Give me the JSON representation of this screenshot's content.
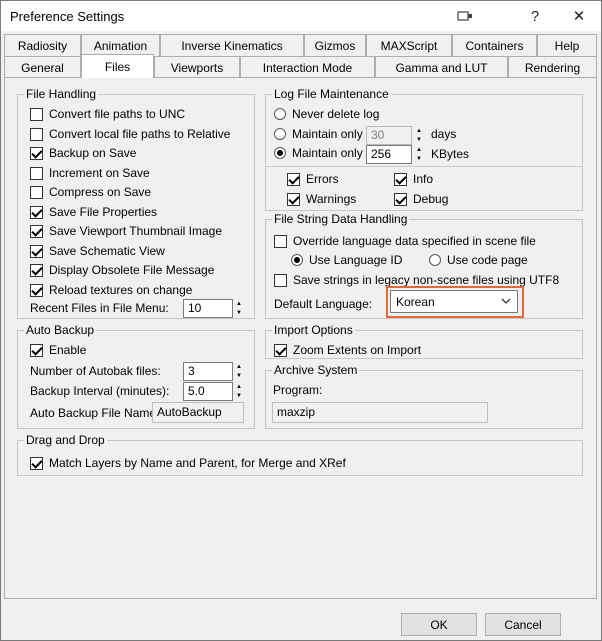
{
  "window": {
    "title": "Preference Settings",
    "help_glyph": "?",
    "close_glyph": "✕"
  },
  "tabs": {
    "row1": [
      "Radiosity",
      "Animation",
      "Inverse Kinematics",
      "Gizmos",
      "MAXScript",
      "Containers",
      "Help"
    ],
    "row2": [
      "General",
      "Files",
      "Viewports",
      "Interaction Mode",
      "Gamma and LUT",
      "Rendering"
    ],
    "active": "Files"
  },
  "file_handling": {
    "title": "File Handling",
    "items": [
      {
        "label": "Convert file paths to UNC",
        "checked": false
      },
      {
        "label": "Convert local file paths to Relative",
        "checked": false
      },
      {
        "label": "Backup on Save",
        "checked": true
      },
      {
        "label": "Increment on Save",
        "checked": false
      },
      {
        "label": "Compress on Save",
        "checked": false
      },
      {
        "label": "Save File Properties",
        "checked": true
      },
      {
        "label": "Save Viewport Thumbnail Image",
        "checked": true
      },
      {
        "label": "Save Schematic View",
        "checked": true
      },
      {
        "label": "Display Obsolete File Message",
        "checked": true
      },
      {
        "label": "Reload textures on change",
        "checked": true
      }
    ],
    "recent_label": "Recent Files in File Menu:",
    "recent_value": "10"
  },
  "log": {
    "title": "Log File Maintenance",
    "never_delete": "Never delete log",
    "maintain_days_label": "Maintain only",
    "days_value": "30",
    "days_unit": "days",
    "maintain_kb_label": "Maintain only",
    "kb_value": "256",
    "kb_unit": "KBytes",
    "errors": "Errors",
    "info": "Info",
    "warnings": "Warnings",
    "debug": "Debug"
  },
  "string_data": {
    "title": "File String Data Handling",
    "override": "Override language data specified in scene file",
    "use_lang_id": "Use Language ID",
    "use_code_page": "Use code page",
    "save_utf8": "Save strings in legacy non-scene files using UTF8",
    "default_lang_label": "Default Language:",
    "default_lang_value": "Korean"
  },
  "auto_backup": {
    "title": "Auto Backup",
    "enable": "Enable",
    "num_label": "Number of Autobak files:",
    "num_value": "3",
    "interval_label": "Backup Interval (minutes):",
    "interval_value": "5.0",
    "name_label": "Auto Backup File Name:",
    "name_value": "AutoBackup"
  },
  "import_options": {
    "title": "Import Options",
    "zoom": "Zoom Extents on Import"
  },
  "archive": {
    "title": "Archive System",
    "program_label": "Program:",
    "program_value": "maxzip"
  },
  "drag_drop": {
    "title": "Drag and Drop",
    "match": "Match Layers by Name and Parent, for Merge and XRef"
  },
  "buttons": {
    "ok": "OK",
    "cancel": "Cancel"
  }
}
